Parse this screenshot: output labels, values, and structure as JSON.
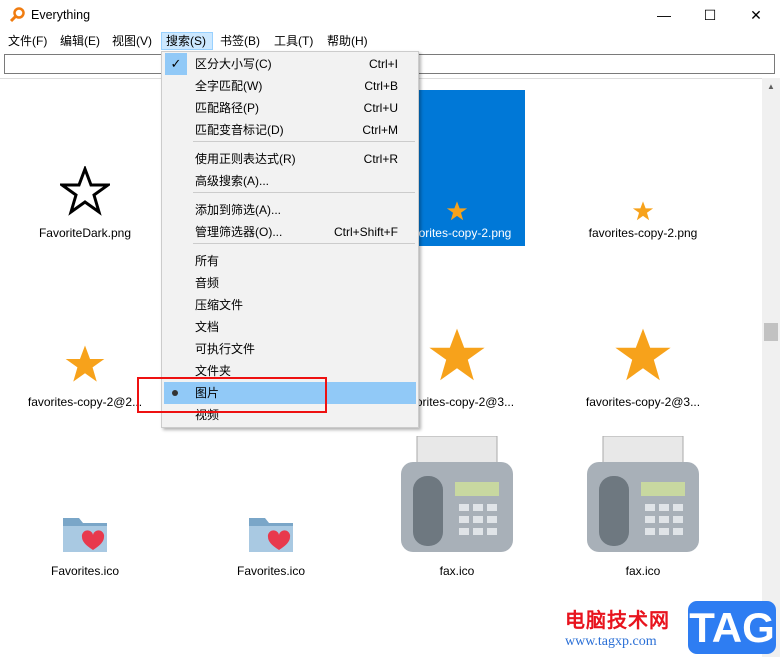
{
  "window": {
    "title": "Everything",
    "minimize": "—",
    "maximize": "☐",
    "close": "✕"
  },
  "menubar": [
    "文件(F)",
    "编辑(E)",
    "视图(V)",
    "搜索(S)",
    "书签(B)",
    "工具(T)",
    "帮助(H)"
  ],
  "search": {
    "value": ""
  },
  "search_menu": {
    "items": [
      {
        "label": "区分大小写(C)",
        "shortcut": "Ctrl+I",
        "checked": true
      },
      {
        "label": "全字匹配(W)",
        "shortcut": "Ctrl+B"
      },
      {
        "label": "匹配路径(P)",
        "shortcut": "Ctrl+U"
      },
      {
        "label": "匹配变音标记(D)",
        "shortcut": "Ctrl+M"
      },
      {
        "label": "使用正则表达式(R)",
        "shortcut": "Ctrl+R"
      },
      {
        "label": "高级搜索(A)...",
        "shortcut": ""
      },
      {
        "label": "添加到筛选(A)...",
        "shortcut": ""
      },
      {
        "label": "管理筛选器(O)...",
        "shortcut": "Ctrl+Shift+F"
      },
      {
        "label": "所有",
        "shortcut": ""
      },
      {
        "label": "音频",
        "shortcut": ""
      },
      {
        "label": "压缩文件",
        "shortcut": ""
      },
      {
        "label": "文档",
        "shortcut": ""
      },
      {
        "label": "可执行文件",
        "shortcut": ""
      },
      {
        "label": "文件夹",
        "shortcut": ""
      },
      {
        "label": "图片",
        "shortcut": "",
        "selected": true
      },
      {
        "label": "视频",
        "shortcut": ""
      }
    ]
  },
  "files": [
    {
      "name": "FavoriteDark.png",
      "icon": "star-outline-icon"
    },
    {
      "name": "",
      "icon": "hidden"
    },
    {
      "name": "favorites-copy-2.png",
      "icon": "star-icon",
      "selected": true
    },
    {
      "name": "favorites-copy-2.png",
      "icon": "star-icon"
    },
    {
      "name": "favorites-copy-2@2...",
      "icon": "star-icon"
    },
    {
      "name": "",
      "icon": "hidden"
    },
    {
      "name": "favorites-copy-2@3...",
      "icon": "star-icon"
    },
    {
      "name": "favorites-copy-2@3...",
      "icon": "star-icon"
    },
    {
      "name": "Favorites.ico",
      "icon": "folder-heart-icon"
    },
    {
      "name": "Favorites.ico",
      "icon": "folder-heart-icon"
    },
    {
      "name": "fax.ico",
      "icon": "fax-icon"
    },
    {
      "name": "fax.ico",
      "icon": "fax-icon"
    }
  ],
  "watermark": {
    "text": "电脑技术网",
    "url": "www.tagxp.com",
    "logo": "TAG"
  },
  "colors": {
    "selection": "#0078d7",
    "menu_highlight": "#91c9f7",
    "star": "#f7a21b"
  }
}
